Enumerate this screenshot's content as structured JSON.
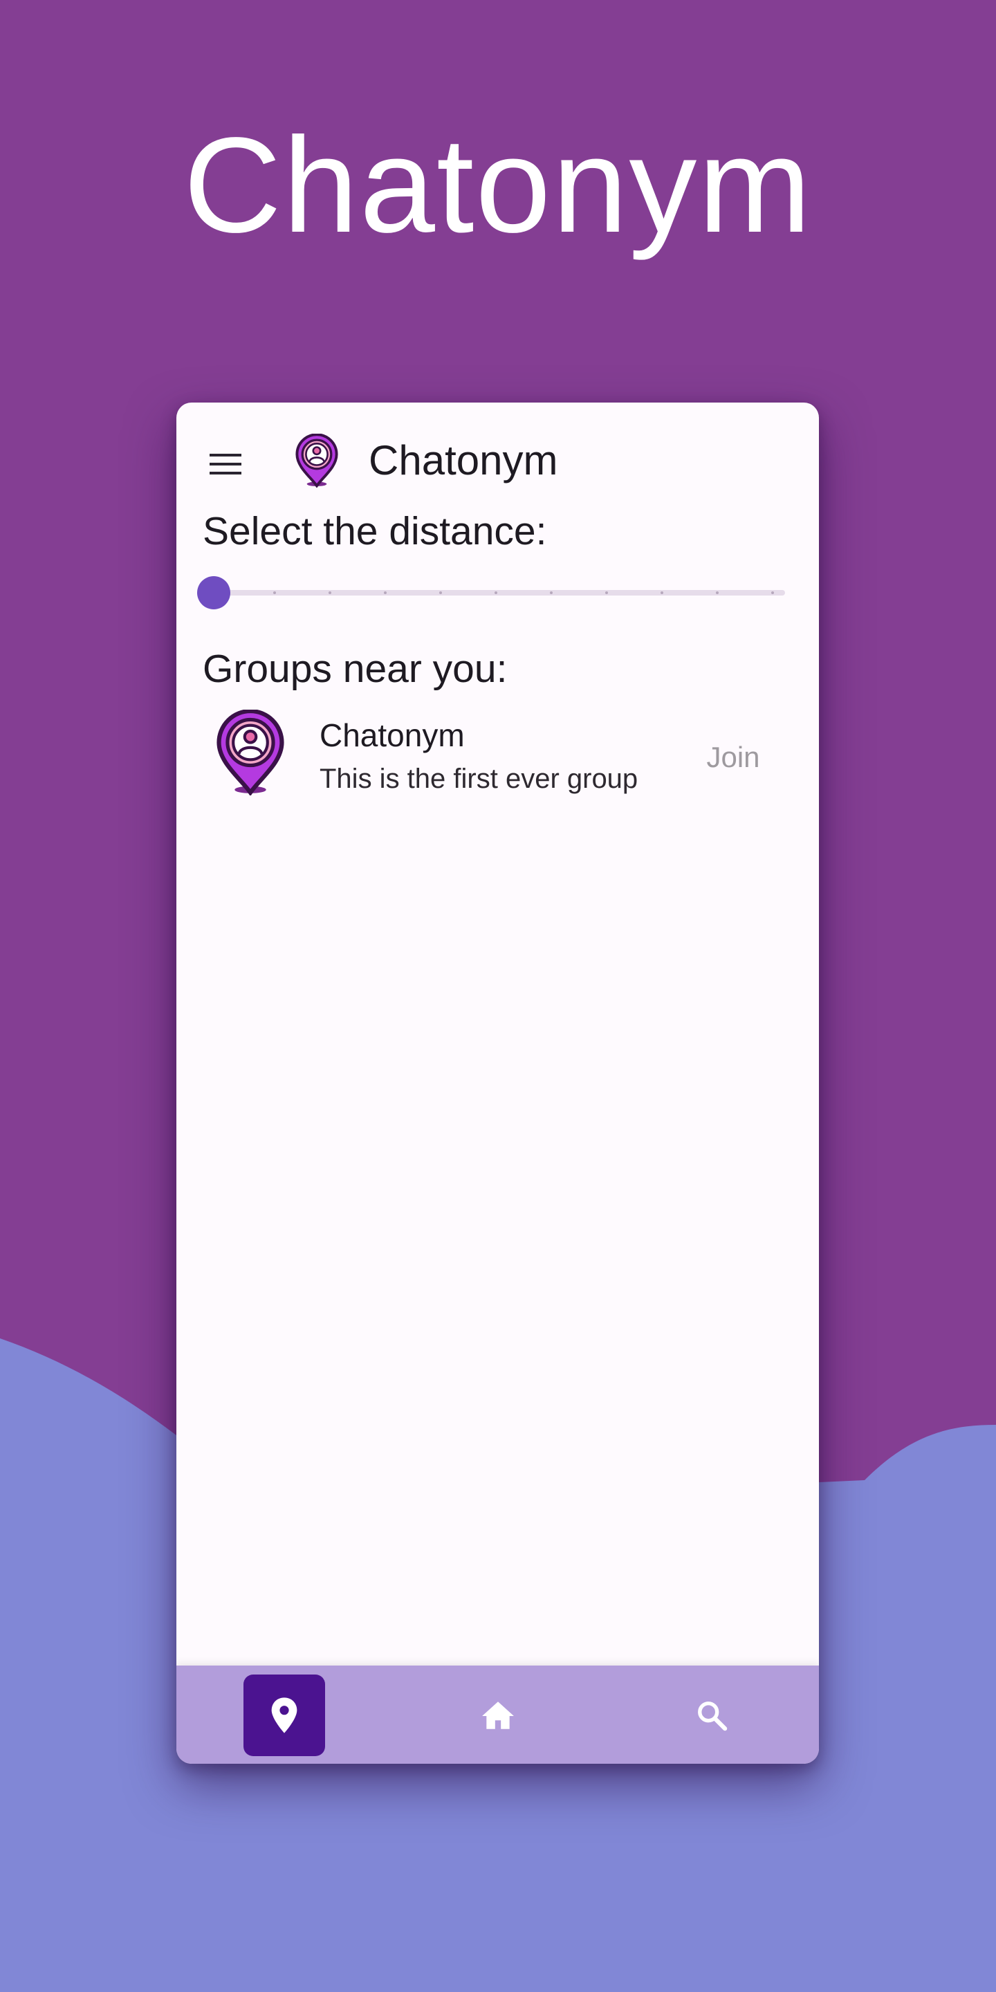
{
  "hero": {
    "title": "Chatonym"
  },
  "colors": {
    "background_top": "#843e93",
    "background_wave": "#8187d6",
    "accent": "#6f4dc1",
    "nav_background": "#b29ddb",
    "nav_active": "#4b1390"
  },
  "app_bar": {
    "menu_icon": "hamburger-menu-icon",
    "logo_icon": "location-person-pin-icon",
    "title": "Chatonym"
  },
  "distance": {
    "label": "Select the distance:",
    "slider_value": 0,
    "slider_divisions": 10
  },
  "groups": {
    "label": "Groups near you:",
    "items": [
      {
        "avatar_icon": "location-person-pin-icon",
        "name": "Chatonym",
        "description": "This is the first ever group",
        "action_label": "Join"
      }
    ]
  },
  "bottom_nav": {
    "items": [
      {
        "icon": "location-pin-icon",
        "active": true
      },
      {
        "icon": "home-icon",
        "active": false
      },
      {
        "icon": "search-icon",
        "active": false
      }
    ]
  }
}
